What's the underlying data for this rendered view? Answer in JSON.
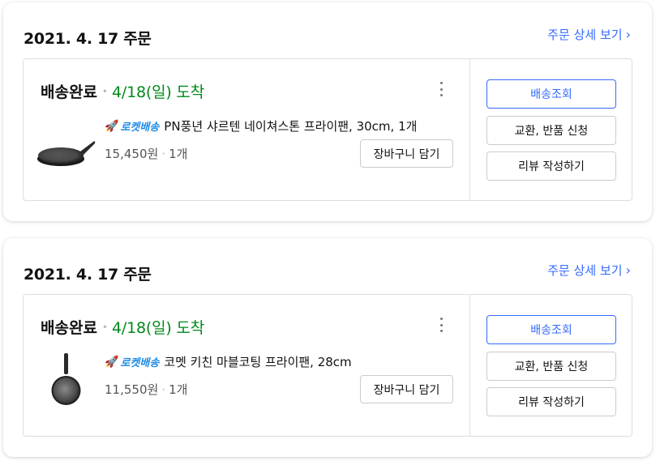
{
  "orders": [
    {
      "date": "2021. 4. 17 주문",
      "detail_link": "주문 상세 보기",
      "status": "배송완료",
      "arrival": "4/18(일) 도착",
      "badge": "로켓배송",
      "product_name": "PN풍년 샤르텐 네이쳐스톤 프라이팬, 30cm, 1개",
      "price": "15,450원",
      "quantity": "1개",
      "cart_button": "장바구니 담기",
      "actions": [
        "배송조회",
        "교환, 반품 신청",
        "리뷰 작성하기"
      ],
      "thumbnail_icon": "frying-pan-side-icon"
    },
    {
      "date": "2021. 4. 17 주문",
      "detail_link": "주문 상세 보기",
      "status": "배송완료",
      "arrival": "4/18(일) 도착",
      "badge": "로켓배송",
      "product_name": "코멧 키친 마블코팅 프라이팬, 28cm",
      "price": "11,550원",
      "quantity": "1개",
      "cart_button": "장바구니 담기",
      "actions": [
        "배송조회",
        "교환, 반품 신청",
        "리뷰 작성하기"
      ],
      "thumbnail_icon": "frying-pan-top-icon"
    }
  ],
  "colors": {
    "link": "#346aff",
    "arrival_green": "#00891a",
    "rocket_blue": "#1f8ce6",
    "border": "#dddddd"
  },
  "icons": {
    "chevron": "chevron-right-icon",
    "more": "more-vertical-icon",
    "rocket": "rocket-icon"
  }
}
